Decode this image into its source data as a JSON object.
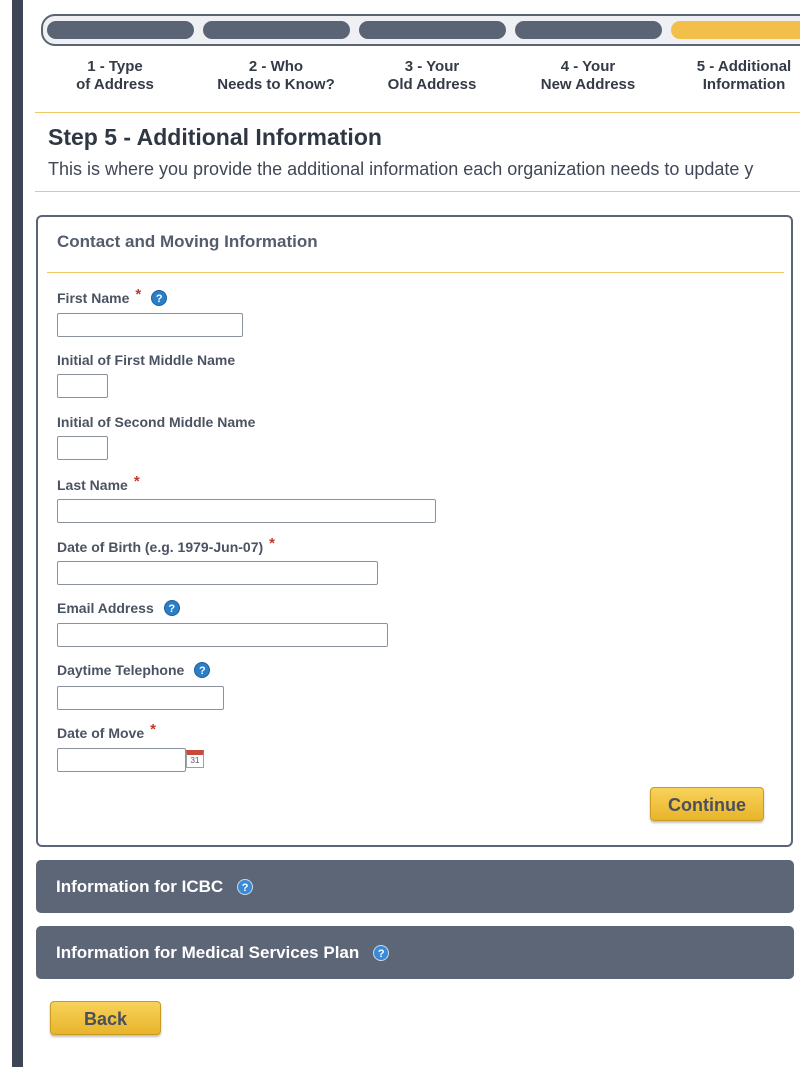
{
  "progress": {
    "steps": [
      {
        "line1": "1 - Type",
        "line2": "of Address"
      },
      {
        "line1": "2 - Who",
        "line2": "Needs to Know?"
      },
      {
        "line1": "3 - Your",
        "line2": "Old Address"
      },
      {
        "line1": "4 - Your",
        "line2": "New Address"
      },
      {
        "line1": "5 - Additional",
        "line2": "Information"
      }
    ],
    "active_step": 5,
    "colors": {
      "inactive": "#5b6474",
      "active": "#f2c04a"
    }
  },
  "page": {
    "title": "Step 5 - Additional Information",
    "description": "This is where you provide the additional information each organization needs to update y"
  },
  "contact_panel": {
    "title": "Contact and Moving Information",
    "fields": {
      "first_name": {
        "label": "First Name",
        "required": "*",
        "value": ""
      },
      "middle1": {
        "label": "Initial of First Middle Name",
        "value": ""
      },
      "middle2": {
        "label": "Initial of Second Middle Name",
        "value": ""
      },
      "last_name": {
        "label": "Last Name",
        "required": "*",
        "value": ""
      },
      "dob": {
        "label": "Date of Birth (e.g. 1979-Jun-07)",
        "required": "*",
        "value": ""
      },
      "email": {
        "label": "Email Address",
        "value": ""
      },
      "phone": {
        "label": "Daytime Telephone",
        "value": ""
      },
      "move_date": {
        "label": "Date of Move",
        "required": "*",
        "value": ""
      }
    },
    "continue_label": "Continue"
  },
  "sections": {
    "icbc": "Information for ICBC",
    "msp": "Information for Medical Services Plan"
  },
  "help_glyph": "?",
  "calendar_glyph": "31",
  "back_label": "Back",
  "accent_color": "#f0c764"
}
